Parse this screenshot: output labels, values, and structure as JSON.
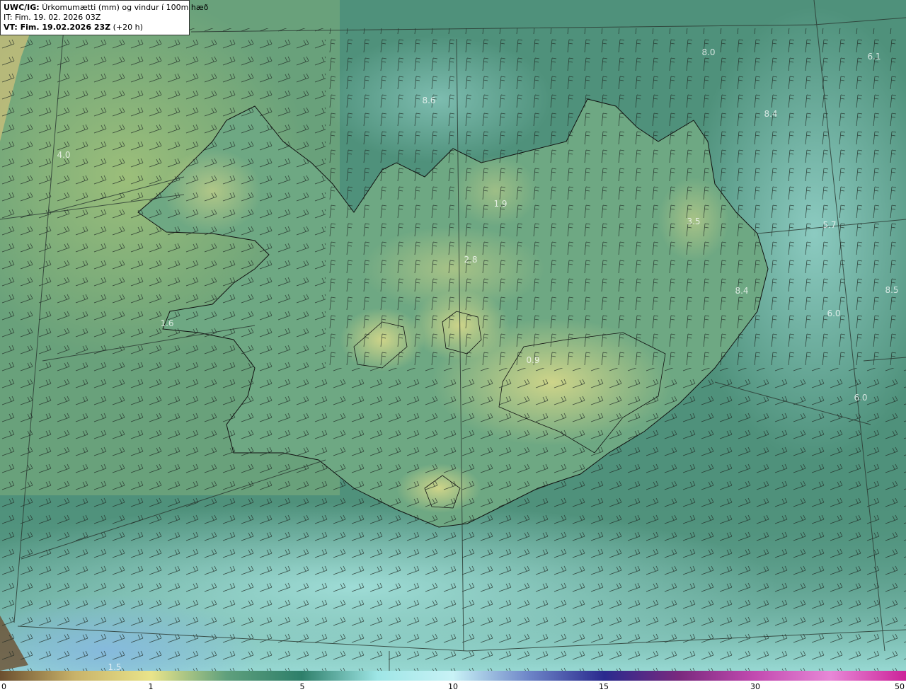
{
  "header": {
    "product": "UWC/IG:",
    "description": "Úrkomumætti (mm) og vindur í 100m hæð",
    "issue_time": "IT: Fim. 19. 02. 2026 03Z",
    "valid_prefix": "VT: Fim. 19.02.2026 23Z",
    "valid_offset": "(+20 h)"
  },
  "colorbar": {
    "ticks": [
      "0",
      "1",
      "5",
      "10",
      "15",
      "30",
      "50"
    ],
    "colors": [
      "#6b4f2f",
      "#c9b36a",
      "#e9e48a",
      "#5fa07d",
      "#2e7f6a",
      "#9ee6e6",
      "#c8f2f6",
      "#6e86c8",
      "#2a2a8e",
      "#7a2a7e",
      "#c24ab0",
      "#e887d6",
      "#cc2299"
    ]
  },
  "map_labels": [
    {
      "text": "8.0"
    },
    {
      "text": "6.1"
    },
    {
      "text": "8.6"
    },
    {
      "text": "8.4"
    },
    {
      "text": "4.0"
    },
    {
      "text": "1.9"
    },
    {
      "text": "3.5"
    },
    {
      "text": "5.7"
    },
    {
      "text": "2.8"
    },
    {
      "text": "8.4"
    },
    {
      "text": "8.5"
    },
    {
      "text": "6.0"
    },
    {
      "text": "1.6"
    },
    {
      "text": "0.9"
    },
    {
      "text": "6.0"
    },
    {
      "text": "1.5"
    }
  ]
}
